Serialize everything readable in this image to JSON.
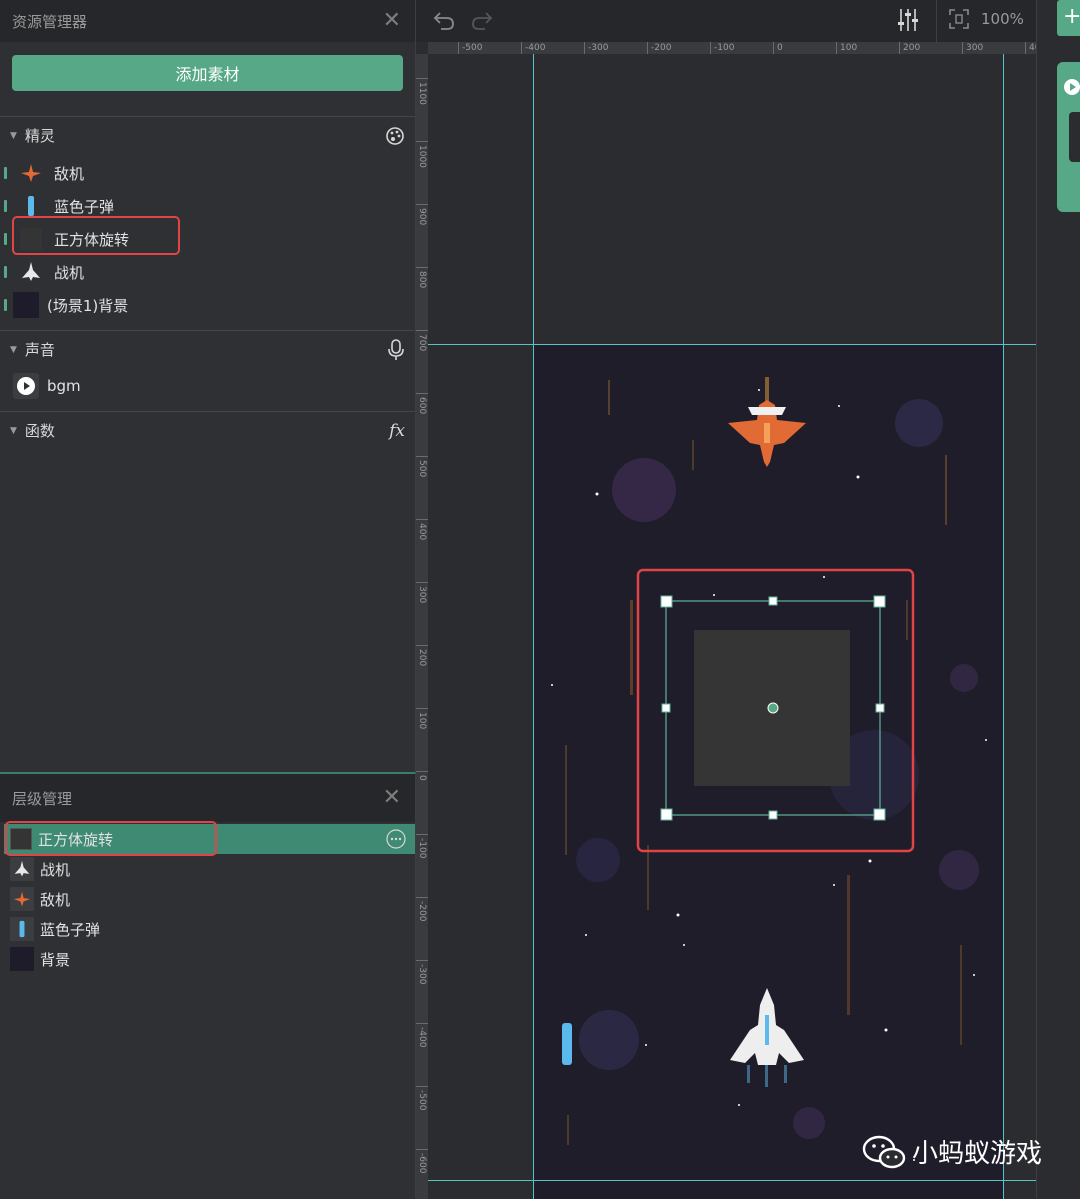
{
  "assets_panel": {
    "title": "资源管理器",
    "add_button": "添加素材",
    "sections": {
      "sprites": {
        "title": "精灵",
        "items": [
          "敌机",
          "蓝色子弹",
          "正方体旋转",
          "战机",
          "(场景1)背景"
        ]
      },
      "sounds": {
        "title": "声音",
        "items": [
          "bgm"
        ]
      },
      "functions": {
        "title": "函数",
        "icon_text": "fx"
      }
    }
  },
  "layers_panel": {
    "title": "层级管理",
    "items": [
      "正方体旋转",
      "战机",
      "敌机",
      "蓝色子弹",
      "背景"
    ]
  },
  "toolbar": {
    "zoom": "100%"
  },
  "ruler": {
    "top": [
      "-500",
      "-400",
      "-300",
      "-200",
      "-100",
      "0",
      "100",
      "200",
      "300",
      "40"
    ],
    "left": [
      "1100",
      "1000",
      "900",
      "800",
      "700",
      "600",
      "500",
      "400",
      "300",
      "200",
      "100",
      "0",
      "-100",
      "-200",
      "-300",
      "-400",
      "-500",
      "-600"
    ]
  },
  "watermark": "小蚂蚁游戏",
  "colors": {
    "accent": "#56a887",
    "highlight": "#e04444",
    "guide": "#57c3c8",
    "stage_bg": "#1f1d2a"
  }
}
